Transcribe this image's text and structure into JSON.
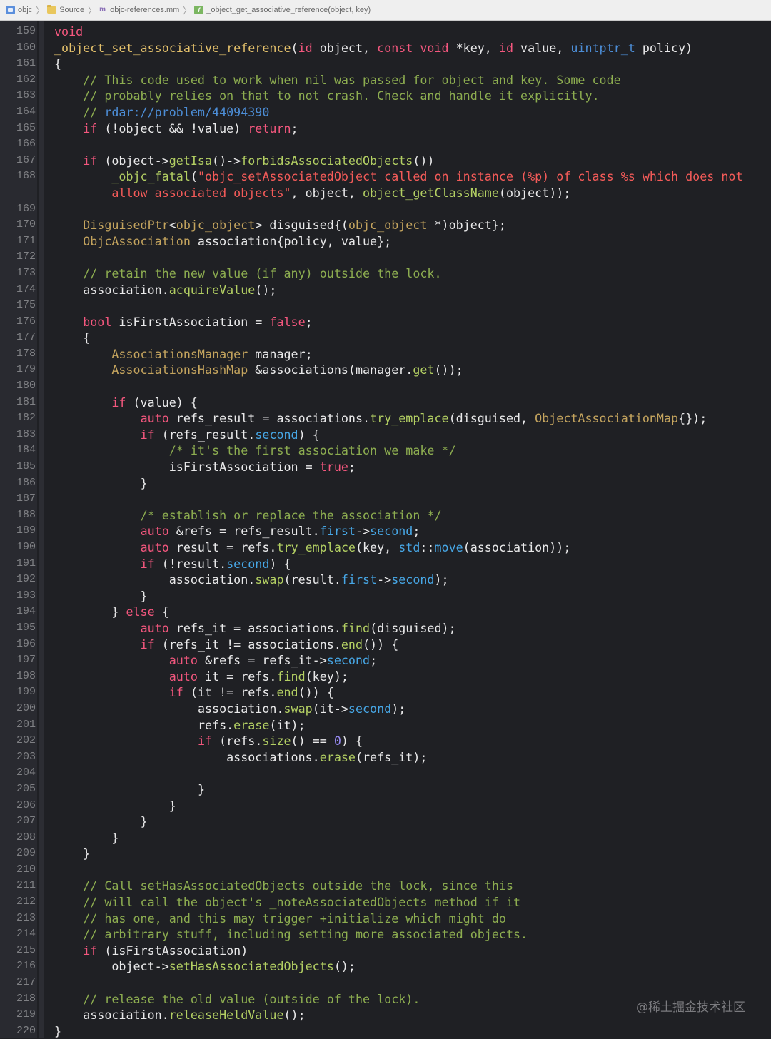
{
  "breadcrumbs": [
    {
      "label": "objc",
      "icon": "project-icon"
    },
    {
      "label": "Source",
      "icon": "folder-icon"
    },
    {
      "label": "objc-references.mm",
      "icon": "objc-file-icon"
    },
    {
      "label": "_object_get_associative_reference(object, key)",
      "icon": "function-icon"
    }
  ],
  "breadcrumb_icon_glyphs": {
    "objc_file": "m",
    "function": "f"
  },
  "watermark": "@稀土掘金技术社区",
  "code_lines": [
    {
      "n": "159",
      "html": "<span class=\"k\">void</span>"
    },
    {
      "n": "160",
      "html": "<span class=\"f\">_object_set_associative_reference</span>(<span class=\"k\">id</span> object, <span class=\"k\">const</span> <span class=\"k\">void</span> *key, <span class=\"k\">id</span> value, <span class=\"u\">uintptr_t</span> policy)"
    },
    {
      "n": "161",
      "html": "{"
    },
    {
      "n": "162",
      "html": "    <span class=\"c\">// This code used to work when nil was passed for object and key. Some code</span>"
    },
    {
      "n": "163",
      "html": "    <span class=\"c\">// probably relies on that to not crash. Check and handle it explicitly.</span>"
    },
    {
      "n": "164",
      "html": "    <span class=\"c\">// </span><span class=\"u\">rdar://problem/44094390</span>"
    },
    {
      "n": "165",
      "html": "    <span class=\"k\">if</span> (!object &amp;&amp; !value) <span class=\"k\">return</span>;"
    },
    {
      "n": "166",
      "html": ""
    },
    {
      "n": "167",
      "html": "    <span class=\"k\">if</span> (object-&gt;<span class=\"m\">getIsa</span>()-&gt;<span class=\"m\">forbidsAssociatedObjects</span>())"
    },
    {
      "n": "168",
      "wrap": true,
      "html": "        <span class=\"m\">_objc_fatal</span>(<span class=\"s\">\"objc_setAssociatedObject called on instance (%p) of class %s which does not</span>\n        <span class=\"s\">allow associated objects\"</span>, object, <span class=\"m\">object_getClassName</span>(object));"
    },
    {
      "n": "169",
      "html": ""
    },
    {
      "n": "170",
      "html": "    <span class=\"t\">DisguisedPtr</span>&lt;<span class=\"t\">objc_object</span>&gt; disguised{(<span class=\"t\">objc_object</span> *)object};"
    },
    {
      "n": "171",
      "html": "    <span class=\"t\">ObjcAssociation</span> association{policy, value};"
    },
    {
      "n": "172",
      "html": ""
    },
    {
      "n": "173",
      "html": "    <span class=\"c\">// retain the new value (if any) outside the lock.</span>"
    },
    {
      "n": "174",
      "html": "    association.<span class=\"m\">acquireValue</span>();"
    },
    {
      "n": "175",
      "html": ""
    },
    {
      "n": "176",
      "html": "    <span class=\"k\">bool</span> isFirstAssociation = <span class=\"k\">false</span>;"
    },
    {
      "n": "177",
      "html": "    {"
    },
    {
      "n": "178",
      "html": "        <span class=\"t\">AssociationsManager</span> manager;"
    },
    {
      "n": "179",
      "html": "        <span class=\"t\">AssociationsHashMap</span> &amp;associations(manager.<span class=\"m\">get</span>());"
    },
    {
      "n": "180",
      "html": ""
    },
    {
      "n": "181",
      "html": "        <span class=\"k\">if</span> (value) {"
    },
    {
      "n": "182",
      "html": "            <span class=\"k\">auto</span> refs_result = associations.<span class=\"m\">try_emplace</span>(disguised, <span class=\"t\">ObjectAssociationMap</span>{});"
    },
    {
      "n": "183",
      "html": "            <span class=\"k\">if</span> (refs_result.<span class=\"pm\">second</span>) {"
    },
    {
      "n": "184",
      "html": "                <span class=\"c\">/* it's the first association we make */</span>"
    },
    {
      "n": "185",
      "html": "                isFirstAssociation = <span class=\"k\">true</span>;"
    },
    {
      "n": "186",
      "html": "            }"
    },
    {
      "n": "187",
      "html": ""
    },
    {
      "n": "188",
      "html": "            <span class=\"c\">/* establish or replace the association */</span>"
    },
    {
      "n": "189",
      "html": "            <span class=\"k\">auto</span> &amp;refs = refs_result.<span class=\"pm\">first</span>-&gt;<span class=\"pm\">second</span>;"
    },
    {
      "n": "190",
      "html": "            <span class=\"k\">auto</span> result = refs.<span class=\"m\">try_emplace</span>(key, <span class=\"pm\">std</span>::<span class=\"pm\">move</span>(association));"
    },
    {
      "n": "191",
      "html": "            <span class=\"k\">if</span> (!result.<span class=\"pm\">second</span>) {"
    },
    {
      "n": "192",
      "html": "                association.<span class=\"m\">swap</span>(result.<span class=\"pm\">first</span>-&gt;<span class=\"pm\">second</span>);"
    },
    {
      "n": "193",
      "html": "            }"
    },
    {
      "n": "194",
      "html": "        } <span class=\"k\">else</span> {"
    },
    {
      "n": "195",
      "html": "            <span class=\"k\">auto</span> refs_it = associations.<span class=\"m\">find</span>(disguised);"
    },
    {
      "n": "196",
      "html": "            <span class=\"k\">if</span> (refs_it != associations.<span class=\"m\">end</span>()) {"
    },
    {
      "n": "197",
      "html": "                <span class=\"k\">auto</span> &amp;refs = refs_it-&gt;<span class=\"pm\">second</span>;"
    },
    {
      "n": "198",
      "html": "                <span class=\"k\">auto</span> it = refs.<span class=\"m\">find</span>(key);"
    },
    {
      "n": "199",
      "html": "                <span class=\"k\">if</span> (it != refs.<span class=\"m\">end</span>()) {"
    },
    {
      "n": "200",
      "html": "                    association.<span class=\"m\">swap</span>(it-&gt;<span class=\"pm\">second</span>);"
    },
    {
      "n": "201",
      "html": "                    refs.<span class=\"m\">erase</span>(it);"
    },
    {
      "n": "202",
      "html": "                    <span class=\"k\">if</span> (refs.<span class=\"m\">size</span>() == <span class=\"n\">0</span>) {"
    },
    {
      "n": "203",
      "html": "                        associations.<span class=\"m\">erase</span>(refs_it);"
    },
    {
      "n": "204",
      "html": ""
    },
    {
      "n": "205",
      "html": "                    }"
    },
    {
      "n": "206",
      "html": "                }"
    },
    {
      "n": "207",
      "html": "            }"
    },
    {
      "n": "208",
      "html": "        }"
    },
    {
      "n": "209",
      "html": "    }"
    },
    {
      "n": "210",
      "html": ""
    },
    {
      "n": "211",
      "html": "    <span class=\"c\">// Call setHasAssociatedObjects outside the lock, since this</span>"
    },
    {
      "n": "212",
      "html": "    <span class=\"c\">// will call the object's _noteAssociatedObjects method if it</span>"
    },
    {
      "n": "213",
      "html": "    <span class=\"c\">// has one, and this may trigger +initialize which might do</span>"
    },
    {
      "n": "214",
      "html": "    <span class=\"c\">// arbitrary stuff, including setting more associated objects.</span>"
    },
    {
      "n": "215",
      "html": "    <span class=\"k\">if</span> (isFirstAssociation)"
    },
    {
      "n": "216",
      "html": "        object-&gt;<span class=\"m\">setHasAssociatedObjects</span>();"
    },
    {
      "n": "217",
      "html": ""
    },
    {
      "n": "218",
      "html": "    <span class=\"c\">// release the old value (outside of the lock).</span>"
    },
    {
      "n": "219",
      "html": "    association.<span class=\"m\">releaseHeldValue</span>();"
    },
    {
      "n": "220",
      "html": "}"
    }
  ],
  "theme_colors": {
    "background": "#1f2024",
    "gutter": "#292a30",
    "keyword": "#f4577e",
    "function_decl": "#e3c06b",
    "method": "#b3cf63",
    "type": "#c4a45e",
    "comment": "#8dad50",
    "string": "#f45b59",
    "url": "#4c8dd6",
    "number": "#9588f0",
    "property": "#47a7e6"
  }
}
